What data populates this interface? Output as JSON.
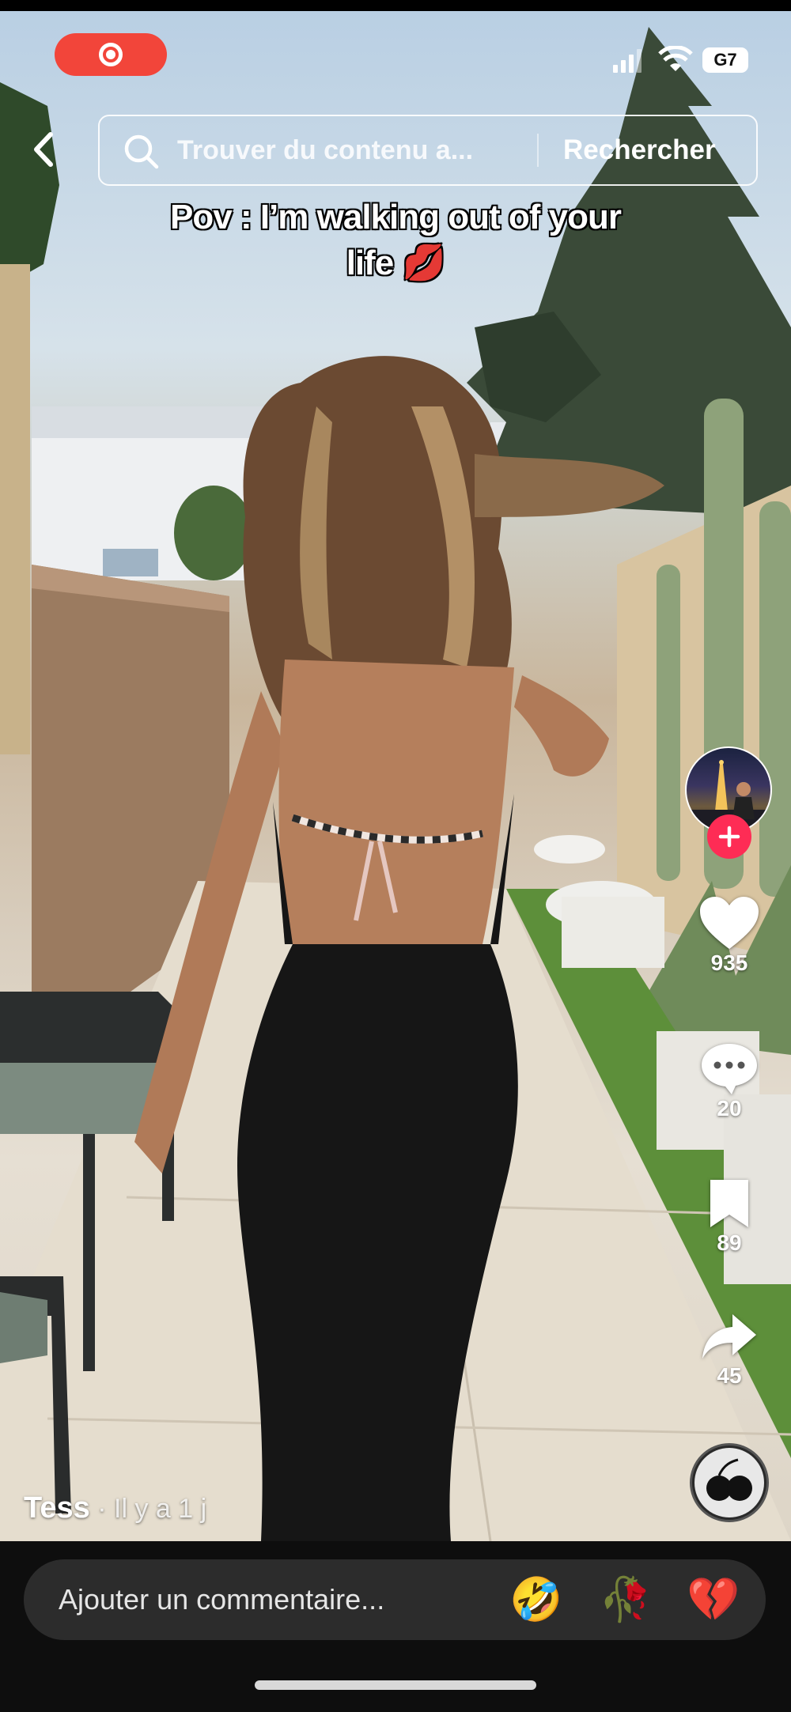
{
  "status_bar": {
    "network": "G7"
  },
  "search": {
    "placeholder": "Trouver du contenu a...",
    "button": "Rechercher"
  },
  "caption": {
    "line1": "Pov : I’m walking out of your",
    "line2": "life 💋"
  },
  "actions": {
    "likes": "935",
    "comments": "20",
    "saves": "89",
    "shares": "45"
  },
  "author": {
    "name": "Tess",
    "time": " · Il y a 1 j"
  },
  "comment_bar": {
    "placeholder": "Ajouter un commentaire...",
    "emojis": [
      "🤣",
      "🥀",
      "💔"
    ]
  },
  "colors": {
    "follow": "#fe2c55",
    "record": "#f2453a",
    "heart": "#ffffff"
  }
}
